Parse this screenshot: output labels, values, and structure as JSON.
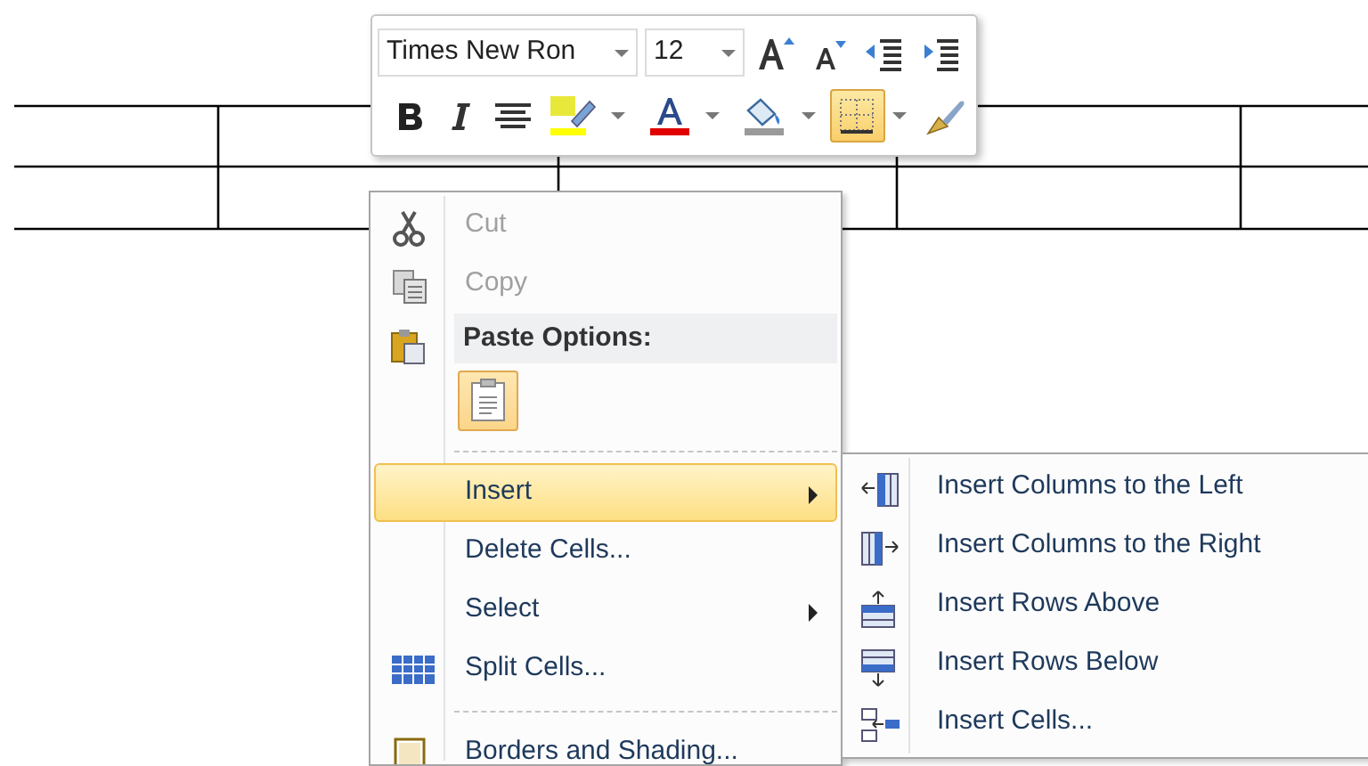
{
  "mini_toolbar": {
    "font_name": {
      "value": "Times New Ron"
    },
    "font_size": {
      "value": "12"
    },
    "buttons": [
      {
        "kind": "grow-font",
        "pressed": false
      },
      {
        "kind": "shrink-font",
        "pressed": false
      },
      {
        "kind": "decrease-indent",
        "pressed": false
      },
      {
        "kind": "increase-indent",
        "pressed": false
      },
      {
        "kind": "bold",
        "pressed": false
      },
      {
        "kind": "italic",
        "pressed": false
      },
      {
        "kind": "center",
        "pressed": false
      },
      {
        "kind": "highlight",
        "pressed": false
      },
      {
        "kind": "font-color",
        "pressed": false
      },
      {
        "kind": "shading",
        "pressed": false
      },
      {
        "kind": "borders",
        "pressed": true
      },
      {
        "kind": "format-painter",
        "pressed": false
      }
    ]
  },
  "context_menu": {
    "items": [
      {
        "kind": "item",
        "label": "Cut",
        "disabled": true,
        "selected": false,
        "has_submenu": false
      },
      {
        "kind": "item",
        "label": "Copy",
        "disabled": true,
        "selected": false,
        "has_submenu": false
      },
      {
        "kind": "header",
        "label": "Paste Options:"
      },
      {
        "kind": "paste-options"
      },
      {
        "kind": "separator"
      },
      {
        "kind": "item",
        "label": "Insert",
        "disabled": false,
        "selected": true,
        "has_submenu": true
      },
      {
        "kind": "item",
        "label": "Delete Cells...",
        "disabled": false,
        "selected": false,
        "has_submenu": false
      },
      {
        "kind": "item",
        "label": "Select",
        "disabled": false,
        "selected": false,
        "has_submenu": true
      },
      {
        "kind": "item",
        "label": "Split Cells...",
        "disabled": false,
        "selected": false,
        "has_submenu": false
      },
      {
        "kind": "separator"
      },
      {
        "kind": "item",
        "label": "Borders and Shading...",
        "disabled": false,
        "selected": false,
        "has_submenu": false
      }
    ]
  },
  "submenu": {
    "items": [
      {
        "label": "Insert Columns to the Left",
        "selected": false
      },
      {
        "label": "Insert Columns to the Right",
        "selected": false
      },
      {
        "label": "Insert Rows Above",
        "selected": false
      },
      {
        "label": "Insert Rows Below",
        "selected": false
      },
      {
        "label": "Insert Cells...",
        "selected": false
      }
    ]
  }
}
